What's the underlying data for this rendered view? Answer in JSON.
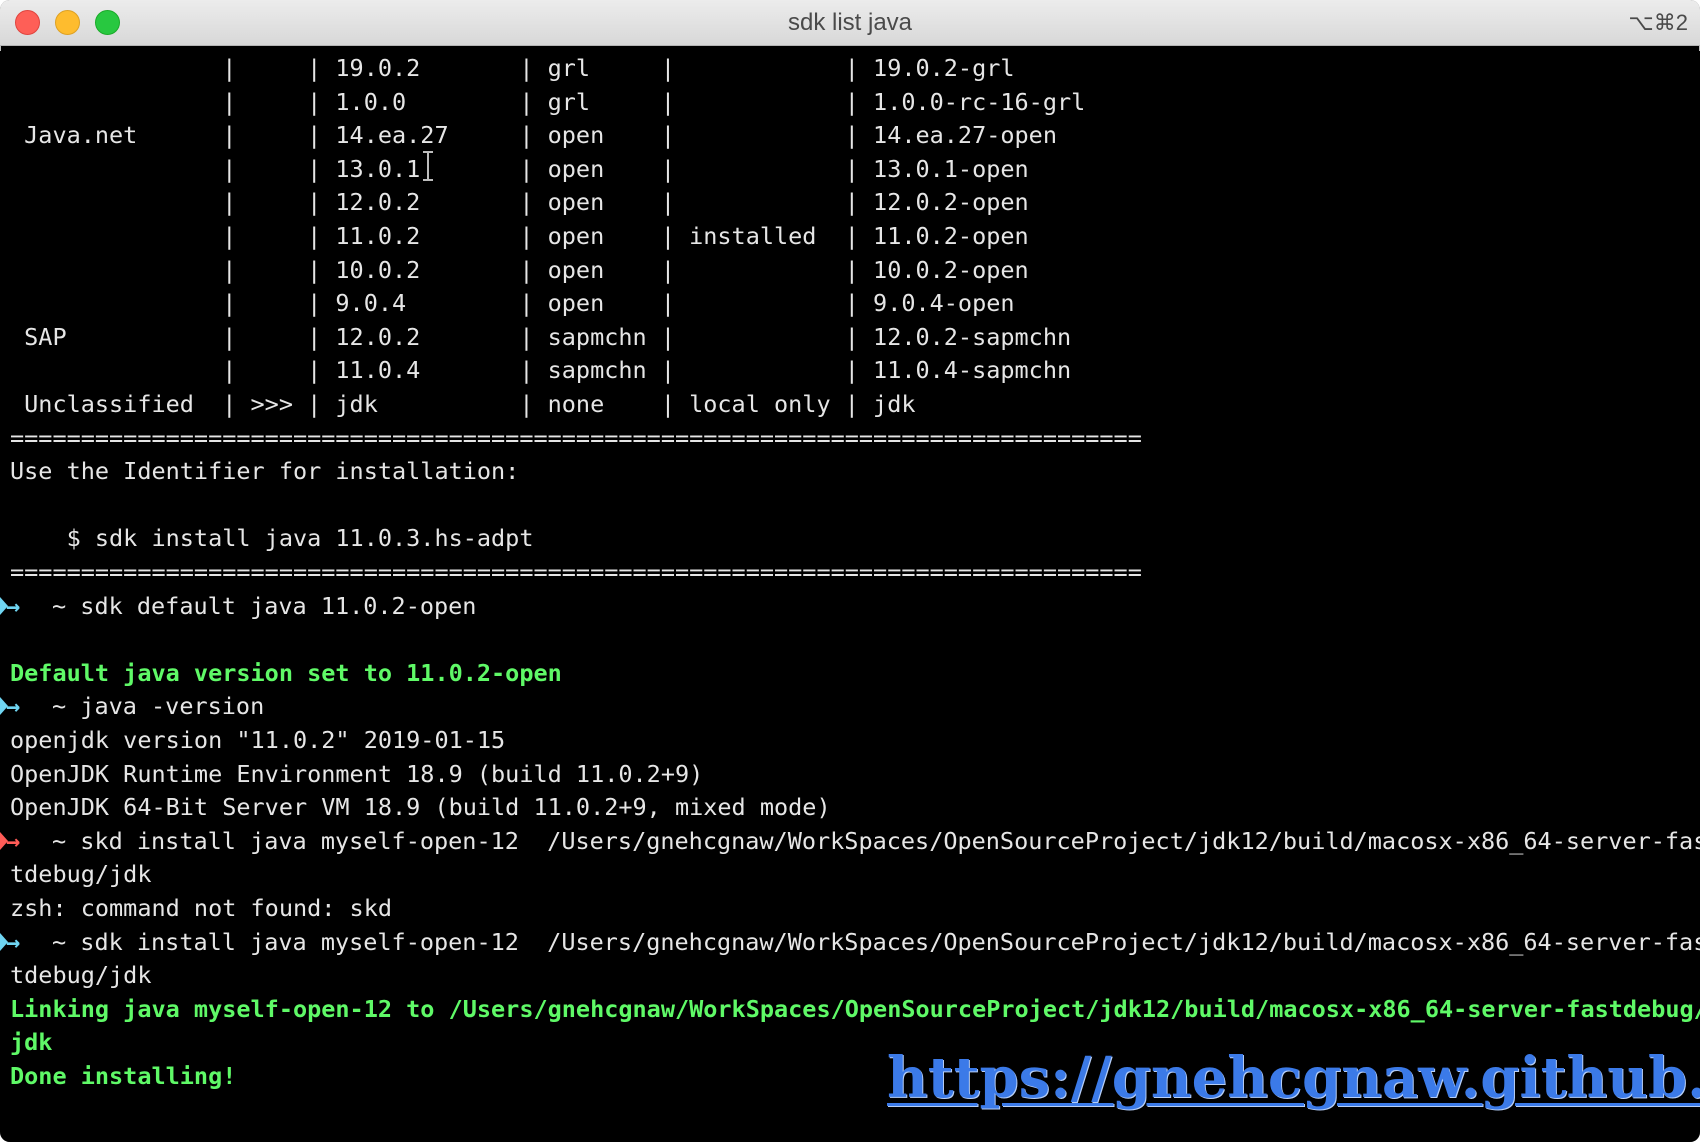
{
  "window": {
    "title": "sdk list java",
    "shortcut": "⌥⌘2"
  },
  "colors": {
    "terminal_bg": "#000000",
    "text": "#e6e6e6",
    "success": "#5ff967",
    "prompt_ok": "#6fd5f2",
    "prompt_err": "#ff5c57",
    "watermark": "#3b7ae8"
  },
  "terminal": {
    "table_rows": [
      " |     | 19.0.2       | grl     |            | 19.0.2-grl",
      " |     | 1.0.0        | grl     |            | 1.0.0-rc-16-grl",
      " Java.net      |     | 14.ea.27     | open    |            | 14.ea.27-open",
      " |     | 13.0.1       | open    |            | 13.0.1-open",
      " |     | 12.0.2       | open    |            | 12.0.2-open",
      " |     | 11.0.2       | open    | installed  | 11.0.2-open",
      " |     | 10.0.2       | open    |            | 10.0.2-open",
      " |     | 9.0.4        | open    |            | 9.0.4-open",
      " SAP           |     | 12.0.2       | sapmchn |            | 12.0.2-sapmchn",
      " |     | 11.0.4       | sapmchn |            | 11.0.4-sapmchn",
      " Unclassified  | >>> | jdk          | none    | local only | jdk"
    ],
    "separator": "================================================================================",
    "hint": "Use the Identifier for installation:",
    "hint_cmd": "    $ sdk install java 11.0.3.hs-adpt",
    "session": [
      {
        "kind": "prompt",
        "status": "ok",
        "text": "~ sdk default java 11.0.2-open"
      },
      {
        "kind": "blank",
        "text": ""
      },
      {
        "kind": "success",
        "text": "Default java version set to 11.0.2-open"
      },
      {
        "kind": "prompt",
        "status": "ok",
        "text": "~ java -version"
      },
      {
        "kind": "output",
        "text": "openjdk version \"11.0.2\" 2019-01-15"
      },
      {
        "kind": "output",
        "text": "OpenJDK Runtime Environment 18.9 (build 11.0.2+9)"
      },
      {
        "kind": "output",
        "text": "OpenJDK 64-Bit Server VM 18.9 (build 11.0.2+9, mixed mode)"
      },
      {
        "kind": "prompt",
        "status": "err",
        "text": "~ skd install java myself-open-12  /Users/gnehcgnaw/WorkSpaces/OpenSourceProject/jdk12/build/macosx-x86_64-server-fas"
      },
      {
        "kind": "output",
        "text": "tdebug/jdk"
      },
      {
        "kind": "output",
        "text": "zsh: command not found: skd"
      },
      {
        "kind": "prompt",
        "status": "ok",
        "text": "~ sdk install java myself-open-12  /Users/gnehcgnaw/WorkSpaces/OpenSourceProject/jdk12/build/macosx-x86_64-server-fas"
      },
      {
        "kind": "output",
        "text": "tdebug/jdk"
      },
      {
        "kind": "success",
        "text": "Linking java myself-open-12 to /Users/gnehcgnaw/WorkSpaces/OpenSourceProject/jdk12/build/macosx-x86_64-server-fastdebug/"
      },
      {
        "kind": "success",
        "text": "jdk"
      },
      {
        "kind": "success",
        "text": "Done installing!"
      }
    ],
    "prompt_glyph": "→"
  },
  "watermark": {
    "text": "https://gnehcgnaw.github.io/"
  }
}
